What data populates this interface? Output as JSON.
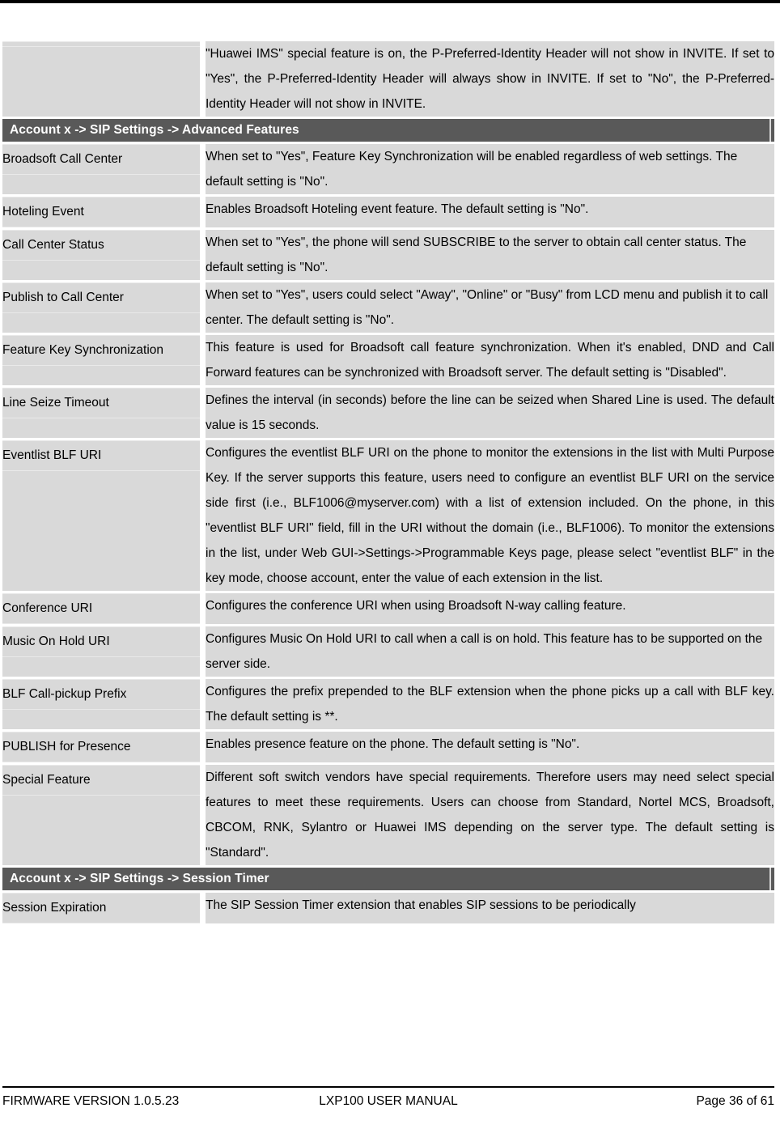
{
  "document": {
    "footer": {
      "firmware": "FIRMWARE VERSION 1.0.5.23",
      "manual": "LXP100 USER MANUAL",
      "page": "Page 36 of 61"
    }
  },
  "table": {
    "rows": [
      {
        "type": "data",
        "label": "",
        "description": "\"Huawei IMS\" special feature is on, the P-Preferred-Identity Header will not show in INVITE. If set to \"Yes\", the P-Preferred-Identity Header will always show in INVITE. If set to \"No\", the P-Preferred-Identity Header will not show in INVITE.",
        "align": "justify"
      },
      {
        "type": "section",
        "title": "Account x -> SIP Settings -> Advanced Features"
      },
      {
        "type": "data",
        "label": "Broadsoft Call Center",
        "description": "When set to \"Yes\", Feature Key Synchronization will be enabled regardless of web settings. The default setting is \"No\".",
        "align": "left"
      },
      {
        "type": "data",
        "label": "Hoteling Event",
        "description": "Enables Broadsoft Hoteling event feature. The default setting is \"No\".",
        "align": "left"
      },
      {
        "type": "data",
        "label": "Call Center Status",
        "description": "When set to \"Yes\", the phone will send SUBSCRIBE to the server to obtain call center status. The default setting is \"No\".",
        "align": "left"
      },
      {
        "type": "data",
        "label": "Publish to Call Center",
        "description": "When set to \"Yes\", users could select \"Away\", \"Online\" or \"Busy\" from LCD menu and publish it to call center. The default setting is \"No\".",
        "align": "left"
      },
      {
        "type": "data",
        "label": "Feature Key Synchronization",
        "description": "This feature is used for Broadsoft call feature synchronization. When it's enabled, DND and Call Forward features can be synchronized with Broadsoft server. The default setting is \"Disabled\".",
        "align": "justify"
      },
      {
        "type": "data",
        "label": "Line Seize Timeout",
        "description": "Defines the interval (in seconds) before the line can be seized when Shared Line is used. The default value is 15 seconds.",
        "align": "justify"
      },
      {
        "type": "data",
        "label": "Eventlist BLF URI",
        "description": "Configures the eventlist BLF URI on the phone to monitor the extensions in the list with Multi Purpose Key. If the server supports this feature, users need to configure an eventlist BLF URI on the service side first (i.e., BLF1006@myserver.com) with a list of extension included. On the phone, in this \"eventlist BLF URI\" field, fill in the URI without the domain (i.e., BLF1006). To monitor the extensions in the list, under Web GUI->Settings->Programmable Keys page, please select \"eventlist BLF\" in the key mode, choose account, enter the value of each extension in the list.",
        "align": "justify"
      },
      {
        "type": "data",
        "label": "Conference URI",
        "description": "Configures the conference URI when using Broadsoft N-way calling feature.",
        "align": "left"
      },
      {
        "type": "data",
        "label": "Music On Hold URI",
        "description": "Configures Music On Hold URI to call when a call is on hold. This feature has to be supported on the server side.",
        "align": "left"
      },
      {
        "type": "data",
        "label": "BLF Call-pickup Prefix",
        "description": "Configures the prefix prepended to the BLF extension when the phone picks up a call with BLF key. The default setting is **.",
        "align": "justify"
      },
      {
        "type": "data",
        "label": "PUBLISH for Presence",
        "description": "Enables presence feature on the phone. The default setting is \"No\".",
        "align": "left"
      },
      {
        "type": "data",
        "label": "Special Feature",
        "description": "Different soft switch vendors have special requirements. Therefore users may need select special features to meet these requirements. Users can choose from Standard, Nortel MCS, Broadsoft, CBCOM, RNK, Sylantro or Huawei IMS depending on the server type. The default setting is \"Standard\".",
        "align": "justify"
      },
      {
        "type": "section",
        "title": "Account x -> SIP Settings -> Session Timer"
      },
      {
        "type": "data",
        "label": "Session Expiration",
        "description": "The SIP Session Timer extension that enables SIP sessions to be periodically",
        "align": "left"
      }
    ]
  }
}
